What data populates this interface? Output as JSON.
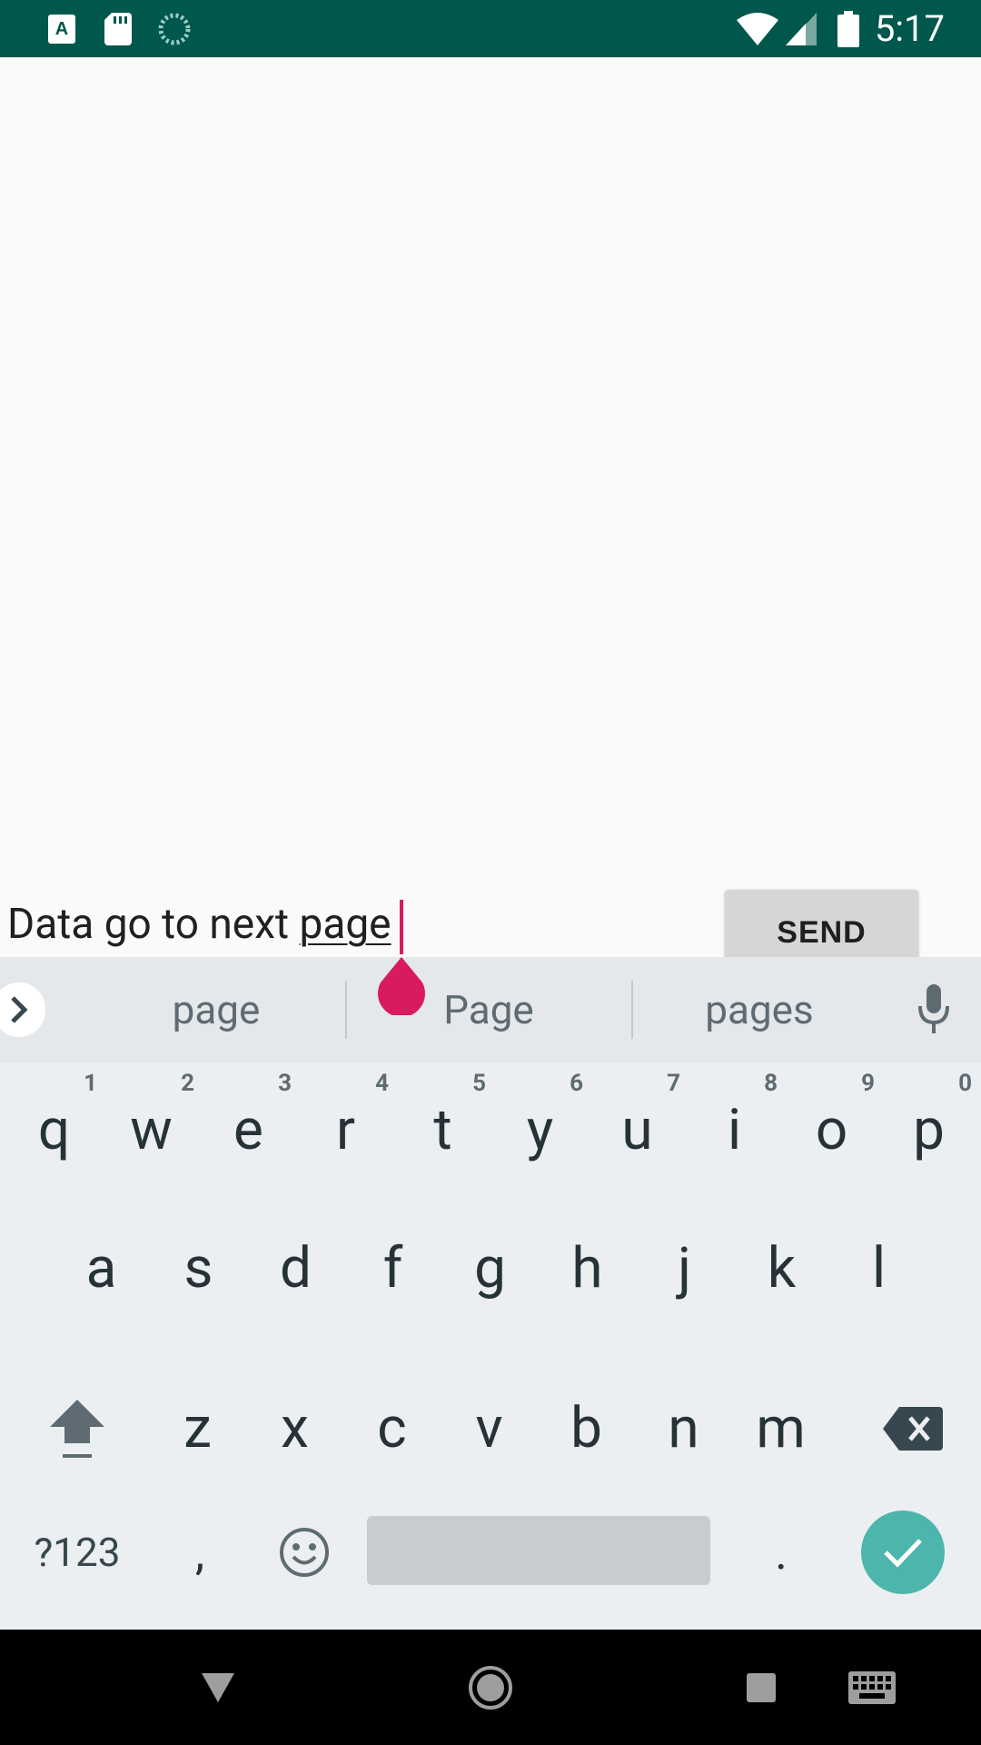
{
  "status_bar": {
    "time": "5:17",
    "icons_left": [
      "text-input-icon",
      "sd-card-icon",
      "sync-spinner-icon"
    ],
    "icons_right": [
      "wifi-icon",
      "signal-icon",
      "battery-icon"
    ]
  },
  "compose": {
    "text_prefix": "Data go to next ",
    "composing_word": "page",
    "send_label": "SEND"
  },
  "keyboard": {
    "suggestions": [
      "page",
      "Page",
      "pages"
    ],
    "row1": [
      {
        "key": "q",
        "hint": "1"
      },
      {
        "key": "w",
        "hint": "2"
      },
      {
        "key": "e",
        "hint": "3"
      },
      {
        "key": "r",
        "hint": "4"
      },
      {
        "key": "t",
        "hint": "5"
      },
      {
        "key": "y",
        "hint": "6"
      },
      {
        "key": "u",
        "hint": "7"
      },
      {
        "key": "i",
        "hint": "8"
      },
      {
        "key": "o",
        "hint": "9"
      },
      {
        "key": "p",
        "hint": "0"
      }
    ],
    "row2": [
      "a",
      "s",
      "d",
      "f",
      "g",
      "h",
      "j",
      "k",
      "l"
    ],
    "row3": [
      "z",
      "x",
      "c",
      "v",
      "b",
      "n",
      "m"
    ],
    "symbols_label": "?123",
    "comma": ",",
    "period": "."
  },
  "colors": {
    "status_bar": "#00574b",
    "accent": "#d81b60",
    "enter_key": "#4db6ac"
  }
}
